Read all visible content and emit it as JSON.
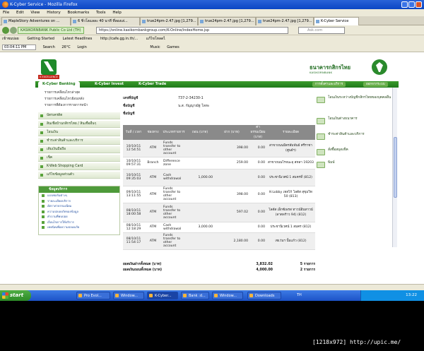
{
  "window": {
    "title": "K-Cyber Service - Mozilla Firefox"
  },
  "menubar": [
    "File",
    "Edit",
    "View",
    "History",
    "Bookmarks",
    "Tools",
    "Help"
  ],
  "tabs": [
    {
      "label": "MapleStory Adventures on ..."
    },
    {
      "label": "6 ชิ่วโลแลละ 40 นาที ที่ลองเล่..."
    },
    {
      "label": "true24pm-2.47.jpg [1,279..."
    },
    {
      "label": "true24pm-2.47.jpg [1,279..."
    },
    {
      "label": "true24pm-2.47.jpg [1,279..."
    },
    {
      "label": "K-Cyber Service"
    }
  ],
  "navbar": {
    "site_identity": "KASIKORNBANK Public Co Ltd (TH)",
    "url": "https://online.kasikornbankgroup.com/K-Online/indexHome.jsp",
    "search_placeholder": "Ask.com"
  },
  "bookmarks": [
    "เข้าชมบ่อย",
    "Getting Started",
    "Latest Headlines",
    "http://cafe.gg.in.th/...",
    "แก้ไขโหลดไ"
  ],
  "toolbar2": {
    "location": "03:04:11 PM",
    "items": [
      "Search",
      "26°C",
      "Login",
      "Music",
      "Games"
    ]
  },
  "page": {
    "logo_left": "K EXCELLENCE",
    "bank_name": "ธนาคารกสิกรไทย",
    "bank_sub": "KASIKORNBANK",
    "menu_tabs": [
      "K-Cyber Banking",
      "K-Cyber Invest",
      "K-Cyber Trade"
    ],
    "menu_right": [
      "การตั้งค่าและบริการ",
      "ออกจากระบบ"
    ],
    "sidebar_sublinks": [
      "รายการเคลื่อนไหวล่าสุด",
      "รายการเคลื่อนไหวย้อนหลัง",
      "รายการที่ต้องการรายการหน้า"
    ],
    "sidebar_items": [
      "บัตรเครดิต",
      "สินเชื่อบ้านกสิกรไทย / สินเชื่ออื่นๆ",
      "โอนเงิน",
      "ชำระค่าสินค้าและบริการ",
      "เติมเงินมือถือ",
      "เช็ค",
      "K-Web Shopping Card",
      "แก้ไขข้อมูลส่วนตัว"
    ],
    "info_box": {
      "title": "ข้อมูลบริการ",
      "items": [
        "แบบฟอร์มต่างๆ",
        "รายละเอียดบริการ",
        "อัตราค่าธรรมเนียม",
        "ความปลอดภัยของข้อมูล",
        "คำถามที่พบบ่อย",
        "เงื่อนไขการให้บริการ",
        "เทคนิคเพื่อความปลอดภัย"
      ]
    },
    "account": {
      "number_label": "เลขที่บัญชี",
      "number": "737-2-34230-1",
      "name_label": "ชื่อบัญชี",
      "name": "น.ส. กัญญาณัฐ โลหะ",
      "name2_label": "ชื่อบัญชี"
    },
    "table": {
      "headers": [
        "วันที่ / เวลา",
        "ช่องทาง",
        "ประเภทรายการ",
        "ถอน (บาท)",
        "ฝาก (บาท)",
        "ค่าธรรมเนียม (บาท)",
        "รายละเอียด"
      ],
      "rows": [
        {
          "date": "10/10/11",
          "time": "12:54:51",
          "channel": "ATM",
          "type": "Funds transfer to other account",
          "withdraw": "",
          "deposit": "398.00",
          "fee": "0.00",
          "detail": "สาขาถนนมิตรสัมพันธ์ ศรีราชา (ศูนย์ฯ)"
        },
        {
          "date": "10/10/11",
          "time": "09:57:31",
          "channel": "Branch",
          "type": "Difference zone",
          "withdraw": "",
          "deposit": "259.00",
          "fee": "0.00",
          "detail": "สาขาถนนโรจนะอุ สหลา 19203"
        },
        {
          "date": "10/10/11",
          "time": "09:35:03",
          "channel": "ATM",
          "type": "Cash withdrawal",
          "withdraw": "1,000.00",
          "deposit": "",
          "fee": "0.00",
          "detail": "ประชานิเวศน์ 1 สมครที่ (812)"
        },
        {
          "date": "09/10/11",
          "time": "13:11:55",
          "channel": "ATM",
          "type": "Funds transfer to other account",
          "withdraw": "",
          "deposit": "398.00",
          "fee": "0.00",
          "detail": "K-Lobby เทสโก้ โลตัส สุขุมวิท 50 (813)"
        },
        {
          "date": "08/10/11",
          "time": "18:00:58",
          "channel": "ATM",
          "type": "Funds transfer to other account",
          "withdraw": "",
          "deposit": "597.02",
          "fee": "0.00",
          "detail": "โลตัส เอ็กซ์เพรส ทาวน์อินทาวน์ (ลาดพร้าว 94) (812)"
        },
        {
          "date": "08/10/11",
          "time": "12:18:29",
          "channel": "ATM",
          "type": "Cash withdrawal",
          "withdraw": "3,000.00",
          "deposit": "",
          "fee": "0.00",
          "detail": "ประชานิเวศน์ 1 สมคร (812)"
        },
        {
          "date": "08/10/11",
          "time": "11:54:17",
          "channel": "ATM",
          "type": "Funds transfer to other account",
          "withdraw": "",
          "deposit": "2,180.00",
          "fee": "0.00",
          "detail": "เซเว่นฯ ปั้มแก้ว (812)"
        }
      ]
    },
    "totals": [
      {
        "label": "ยอดเงินฝากทั้งหมด (บาท)",
        "amount": "3,832.02",
        "count": "5 รายการ"
      },
      {
        "label": "ยอดเงินถอนทั้งหมด (บาท)",
        "amount": "4,000.00",
        "count": "2 รายการ"
      }
    ],
    "right_col": [
      "โอนเงินระหว่างบัญชีกสิกรไทยของบุคคลอื่น",
      "โอนเงินต่างธนาคาร",
      "ชำระค่าสินค้าและบริการ",
      "สั่งซื้อสมุดเช็ค",
      "พิมพ์"
    ]
  },
  "taskbar": {
    "start": "start",
    "items": [
      "Pro Evol...",
      "Window...",
      "K-Cyber...",
      "Bank :d...",
      "Window...",
      "Downloads"
    ],
    "lang": "TH",
    "clock": "13:22"
  },
  "caption": "[1218x972] http://upic.me/"
}
